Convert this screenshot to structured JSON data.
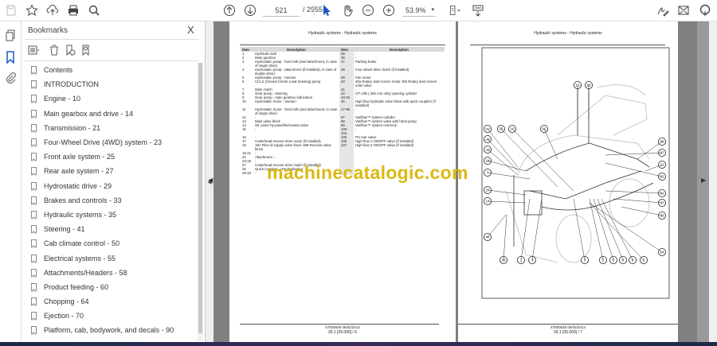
{
  "toolbar": {
    "page_current": "521",
    "page_total": "/ 2955",
    "zoom": "53.9%",
    "icons": [
      "save-icon",
      "star-icon",
      "cloud-upload-icon",
      "print-icon",
      "search-icon",
      "page-up-icon",
      "page-down-icon",
      "select-cursor-icon",
      "hand-icon",
      "zoom-out-icon",
      "zoom-in-icon",
      "fit-page-icon",
      "reading-mode-icon",
      "sign-icon",
      "mail-icon",
      "user-icon"
    ]
  },
  "bookmarks": {
    "title": "Bookmarks",
    "close": "X",
    "items": [
      "Contents",
      "INTRODUCTION",
      "Engine - 10",
      "Main gearbox and drive - 14",
      "Transmission - 21",
      "Four-Wheel Drive (4WD) system - 23",
      "Front axle system - 25",
      "Rear axle system - 27",
      "Hydrostatic drive - 29",
      "Brakes and controls - 33",
      "Hydraulic systems - 35",
      "Steering - 41",
      "Cab climate control - 50",
      "Electrical systems - 55",
      "Attachments/Headers - 58",
      "Product feeding - 60",
      "Chopping - 64",
      "Ejection - 70",
      "Platform, cab, bodywork, and decals - 90"
    ]
  },
  "left_page": {
    "header": "Hydraulic systems - Hydraulic systems",
    "columns": [
      "Item",
      "Description",
      "Item",
      "Description"
    ],
    "rows": [
      [
        "1",
        "Hydraulic tank",
        "35",
        "-"
      ],
      [
        "2",
        "Main gearbox",
        "36",
        "-"
      ],
      [
        "3",
        "Hydrostatic pump - feed rolls (and attachment, in case of single drive)",
        "37",
        "Parking brake"
      ],
      [
        "4",
        "Hydrostatic pump - attachment (if installed), in case of double drive)",
        "38",
        "Four wheel drive clutch (if installed)"
      ],
      [
        "5",
        "Hydrostatic pump - traction",
        "39",
        "Fan motor"
      ],
      [
        "6",
        "CCLS (Closed Centre Load Sensing) pump",
        "40",
        "40a Rotary dust screen motor 40b Rotary dust screen relief valve"
      ],
      [
        "7",
        "Main clutch",
        "41",
        "-"
      ],
      [
        "8",
        "Gear pump - steering",
        "42",
        "CP rolls ( 250 mm only) opening cylinder"
      ],
      [
        "9",
        "Gear pump - main gearbox lubrication",
        "43-45",
        "-"
      ],
      [
        "10",
        "Hydrostatic motor - traction",
        "46",
        "High flow hydraulic valve block with quick couplers (if installed)"
      ],
      [
        "11",
        "Hydrostatic motor - feed rolls (and attachment, in case of single drive)",
        "47-96",
        "-"
      ],
      [
        "12",
        "-",
        "97",
        "Variflow™ system cylinder"
      ],
      [
        "13",
        "Main valve block",
        "98",
        "Variflow™ system valve with hand pump"
      ],
      [
        "14",
        "Oil cooler by-pass/thermostat valve",
        "99",
        "Variflow™ system reservoir"
      ],
      [
        "15",
        "-",
        "100-104",
        "-"
      ],
      [
        "16",
        "-",
        "105",
        "PU rear valve"
      ],
      [
        "17",
        "Cutterhead reverse drive motor (if installed)",
        "106",
        "High flow 1 ON/OFF valve (if installed)"
      ],
      [
        "18",
        "18A Pilot oil supply valve block 18B Reverse valve block",
        "107",
        "High flow 2 ON/OFF valve (if installed)"
      ],
      [
        "19-21",
        "-",
        "",
        ""
      ],
      [
        "22",
        "Attachment ...",
        "",
        ""
      ],
      [
        "23-26",
        "-",
        "",
        ""
      ],
      [
        "27",
        "Cutterhead reverse drive clutch (if installed)",
        "",
        ""
      ],
      [
        "28",
        "Quick couplers - rear hydraulics",
        "",
        ""
      ],
      [
        "29-34",
        "-",
        "",
        ""
      ]
    ],
    "footer_code": "47500836 06/02/2014",
    "footer_page": "35.1 [35.000] / 6"
  },
  "right_page": {
    "header": "Hydraulic systems - Hydraulic systems",
    "callouts": [
      "13",
      "90",
      "107",
      "106",
      "105",
      "18",
      "7",
      "27",
      "17",
      "46",
      "35",
      "10",
      "60",
      "38",
      "97",
      "11",
      "22",
      "42",
      "37",
      "36",
      "14",
      "28",
      "1",
      "4",
      "3",
      "2",
      "5",
      "8",
      "9",
      "6"
    ],
    "footer_code": "47500836 06/02/2014",
    "footer_page": "35.1 [35.000] / 7"
  },
  "watermark": "machinecatalogic.com"
}
